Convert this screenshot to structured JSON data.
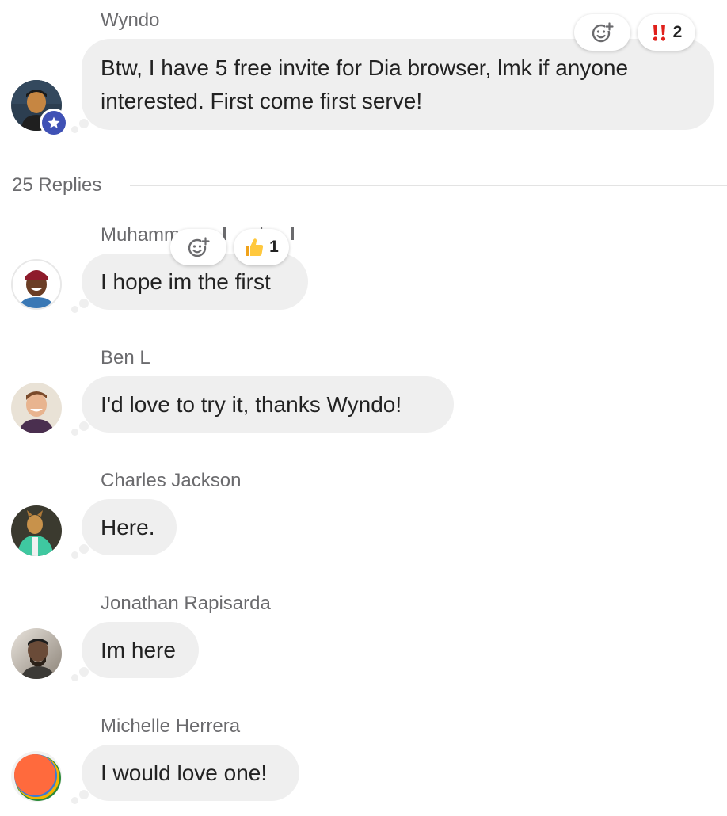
{
  "original_post": {
    "sender": "Wyndo",
    "text": "Btw, I have 5 free invite for Dia browser, lmk if anyone interested. First come first serve!",
    "reactions": [
      {
        "icon": "add-reaction-icon",
        "count": ""
      },
      {
        "icon": "double-exclamation-icon",
        "count": "2"
      }
    ]
  },
  "replies_label": "25 Replies",
  "replies": [
    {
      "sender": "Muhamm",
      "sender_tail": "ako",
      "text": "I hope im the first",
      "reactions": [
        {
          "icon": "add-reaction-icon",
          "count": ""
        },
        {
          "icon": "thumbs-up-icon",
          "count": "1"
        }
      ]
    },
    {
      "sender": "Ben L",
      "text": "I'd love to try it, thanks Wyndo!"
    },
    {
      "sender": "Charles Jackson",
      "text": "Here."
    },
    {
      "sender": "Jonathan Rapisarda",
      "text": "Im here"
    },
    {
      "sender": "Michelle Herrera",
      "text": "I would love one!"
    }
  ],
  "colors": {
    "bubble": "#efefef",
    "admin_badge": "#3f51b5",
    "divider": "#e3e3e3",
    "meta_text": "#6b6b6e"
  }
}
